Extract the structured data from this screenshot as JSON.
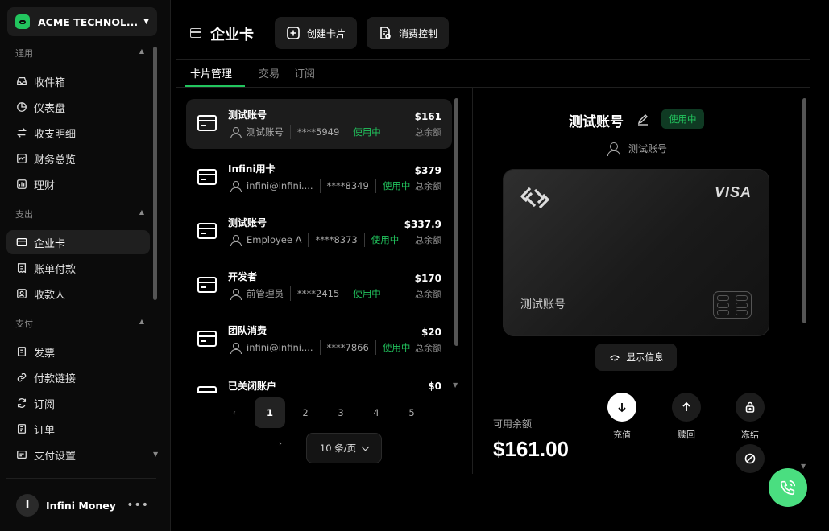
{
  "sidebar": {
    "org_name": "ACME TECHNOL...",
    "sections": [
      {
        "label": "通用",
        "items": [
          {
            "label": "收件箱",
            "icon": "inbox-icon"
          },
          {
            "label": "仪表盘",
            "icon": "dashboard-icon"
          },
          {
            "label": "收支明细",
            "icon": "transactions-icon"
          },
          {
            "label": "财务总览",
            "icon": "overview-icon"
          },
          {
            "label": "理财",
            "icon": "invest-icon"
          }
        ]
      },
      {
        "label": "支出",
        "items": [
          {
            "label": "企业卡",
            "icon": "card-icon",
            "active": true
          },
          {
            "label": "账单付款",
            "icon": "bill-icon"
          },
          {
            "label": "收款人",
            "icon": "payee-icon"
          }
        ]
      },
      {
        "label": "支付",
        "items": [
          {
            "label": "发票",
            "icon": "invoice-icon"
          },
          {
            "label": "付款链接",
            "icon": "link-icon"
          },
          {
            "label": "订阅",
            "icon": "subscription-icon"
          },
          {
            "label": "订单",
            "icon": "order-icon"
          },
          {
            "label": "支付设置",
            "icon": "settings-icon"
          }
        ]
      }
    ],
    "user": {
      "initial": "I",
      "name": "Infini Money",
      "more": "•••"
    }
  },
  "header": {
    "title": "企业卡",
    "create_card": "创建卡片",
    "spend_control": "消费控制"
  },
  "tabs": [
    "卡片管理",
    "交易",
    "订阅"
  ],
  "cards": [
    {
      "name": "测试账号",
      "holder": "测试账号",
      "number": "****5949",
      "status": "使用中",
      "amount": "$161",
      "amount_label": "总余额"
    },
    {
      "name": "Infini用卡",
      "holder": "infini@infini....",
      "number": "****8349",
      "status": "使用中",
      "amount": "$379",
      "amount_label": "总余额"
    },
    {
      "name": "测试账号",
      "holder": "Employee A",
      "number": "****8373",
      "status": "使用中",
      "amount": "$337.9",
      "amount_label": "总余额"
    },
    {
      "name": "开发者",
      "holder": "前管理员",
      "number": "****2415",
      "status": "使用中",
      "amount": "$170",
      "amount_label": "总余额"
    },
    {
      "name": "团队消费",
      "holder": "infini@infini....",
      "number": "****7866",
      "status": "使用中",
      "amount": "$20",
      "amount_label": "总余额"
    },
    {
      "name": "已关闭账户",
      "amount": "$0"
    }
  ],
  "pagination": {
    "prev": "‹",
    "pages": [
      "1",
      "2",
      "3",
      "4",
      "5"
    ],
    "current": "1",
    "next": "›",
    "page_size": "10 条/页"
  },
  "detail": {
    "title": "测试账号",
    "status": "使用中",
    "holder": "测试账号",
    "card_brand": "VISA",
    "card_name": "测试账号",
    "show_info": "显示信息",
    "balance_label": "可用余额",
    "balance": "$161.00",
    "actions": {
      "topup": "充值",
      "withdraw": "赎回",
      "freeze": "冻结"
    }
  }
}
